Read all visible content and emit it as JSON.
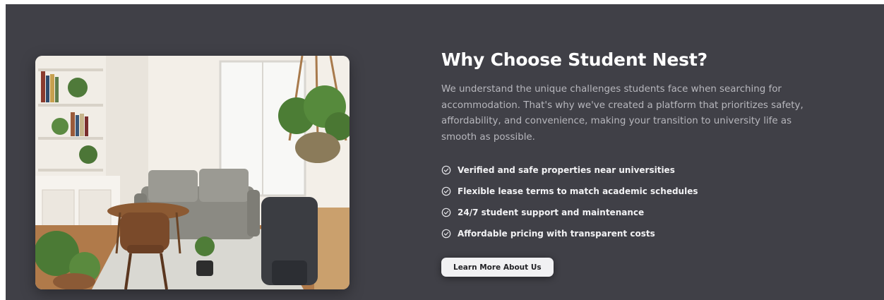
{
  "section": {
    "title": "Why Choose Student Nest?",
    "description": "We understand the unique challenges students face when searching for accommodation. That's why we've created a platform that prioritizes safety, affordability, and convenience, making your transition to university life as smooth as possible.",
    "features": [
      "Verified and safe properties near universities",
      "Flexible lease terms to match academic schedules",
      "24/7 student support and maintenance",
      "Affordable pricing with transparent costs"
    ],
    "feature_icon": "check-circle-icon",
    "cta_label": "Learn More About Us"
  },
  "colors": {
    "section_bg": "#404047",
    "title": "#ffffff",
    "description": "#b7b7bd",
    "feature_text": "#f2f2f4",
    "button_bg": "#f1f1f3",
    "button_text": "#222226"
  }
}
